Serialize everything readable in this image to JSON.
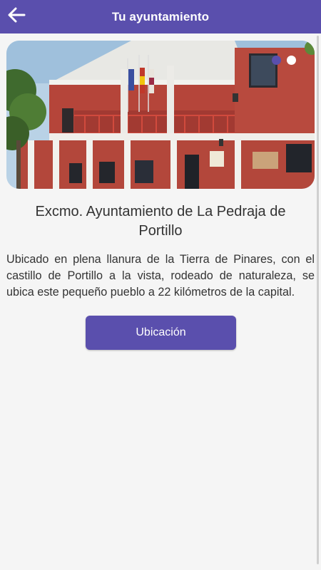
{
  "header": {
    "title": "Tu ayuntamiento",
    "back_icon": "arrow-left-icon"
  },
  "carousel": {
    "image_description": "Fachada de ladrillo rojo del ayuntamiento con balcón y banderas",
    "slide_count": 2,
    "active_index": 0
  },
  "main": {
    "title": "Excmo. Ayuntamiento de La Pedraja de Portillo",
    "description": "Ubicado en plena llanura de la Tierra de Pinares, con el castillo de Portillo a la vista, rodeado de naturaleza, se ubica este pequeño pueblo a 22 kilómetros de la capital.",
    "location_button": "Ubicación"
  },
  "colors": {
    "primary": "#5a4fad",
    "background": "#f5f5f5",
    "text": "#333333"
  }
}
